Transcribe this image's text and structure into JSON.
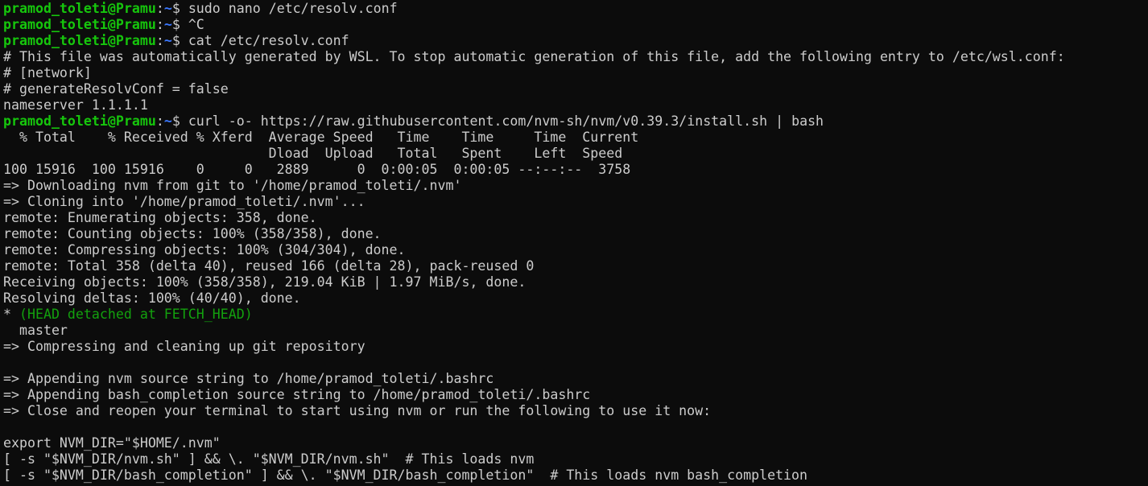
{
  "prompt": {
    "userhost": "pramod_toleti@Pramu",
    "path": "~",
    "symbol": "$ "
  },
  "colors": {
    "background": "#0c0c0c",
    "foreground": "#cccccc",
    "prompt_user": "#16c60c",
    "prompt_path": "#3b78ff",
    "git_branch_head": "#13a10e"
  },
  "lines": [
    {
      "type": "prompt",
      "command": "sudo nano /etc/resolv.conf"
    },
    {
      "type": "prompt",
      "command": "^C"
    },
    {
      "type": "prompt",
      "command": "cat /etc/resolv.conf"
    },
    {
      "type": "output",
      "text": "# This file was automatically generated by WSL. To stop automatic generation of this file, add the following entry to /etc/wsl.conf:"
    },
    {
      "type": "output",
      "text": "# [network]"
    },
    {
      "type": "output",
      "text": "# generateResolvConf = false"
    },
    {
      "type": "output",
      "text": "nameserver 1.1.1.1"
    },
    {
      "type": "prompt",
      "command": "curl -o- https://raw.githubusercontent.com/nvm-sh/nvm/v0.39.3/install.sh | bash"
    },
    {
      "type": "output",
      "text": "  % Total    % Received % Xferd  Average Speed   Time    Time     Time  Current"
    },
    {
      "type": "output",
      "text": "                                 Dload  Upload   Total   Spent    Left  Speed"
    },
    {
      "type": "output",
      "text": "100 15916  100 15916    0     0   2889      0  0:00:05  0:00:05 --:--:--  3758"
    },
    {
      "type": "output",
      "text": "=> Downloading nvm from git to '/home/pramod_toleti/.nvm'"
    },
    {
      "type": "output",
      "text": "=> Cloning into '/home/pramod_toleti/.nvm'..."
    },
    {
      "type": "output",
      "text": "remote: Enumerating objects: 358, done."
    },
    {
      "type": "output",
      "text": "remote: Counting objects: 100% (358/358), done."
    },
    {
      "type": "output",
      "text": "remote: Compressing objects: 100% (304/304), done."
    },
    {
      "type": "output",
      "text": "remote: Total 358 (delta 40), reused 166 (delta 28), pack-reused 0"
    },
    {
      "type": "output",
      "text": "Receiving objects: 100% (358/358), 219.04 KiB | 1.97 MiB/s, done."
    },
    {
      "type": "output",
      "text": "Resolving deltas: 100% (40/40), done."
    },
    {
      "type": "branch",
      "marker": "* ",
      "text": "(HEAD detached at FETCH_HEAD)"
    },
    {
      "type": "output",
      "text": "  master"
    },
    {
      "type": "output",
      "text": "=> Compressing and cleaning up git repository"
    },
    {
      "type": "output",
      "text": ""
    },
    {
      "type": "output",
      "text": "=> Appending nvm source string to /home/pramod_toleti/.bashrc"
    },
    {
      "type": "output",
      "text": "=> Appending bash_completion source string to /home/pramod_toleti/.bashrc"
    },
    {
      "type": "output",
      "text": "=> Close and reopen your terminal to start using nvm or run the following to use it now:"
    },
    {
      "type": "output",
      "text": ""
    },
    {
      "type": "output",
      "text": "export NVM_DIR=\"$HOME/.nvm\""
    },
    {
      "type": "output",
      "text": "[ -s \"$NVM_DIR/nvm.sh\" ] && \\. \"$NVM_DIR/nvm.sh\"  # This loads nvm"
    },
    {
      "type": "output",
      "text": "[ -s \"$NVM_DIR/bash_completion\" ] && \\. \"$NVM_DIR/bash_completion\"  # This loads nvm bash_completion"
    }
  ]
}
